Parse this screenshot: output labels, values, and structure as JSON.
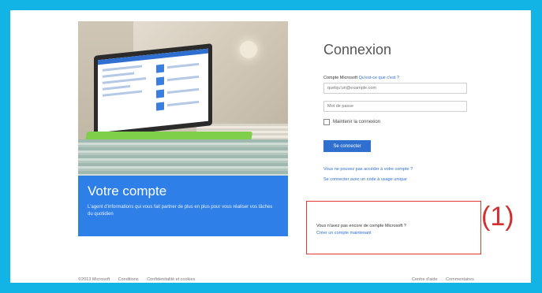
{
  "hero": {
    "title": "Votre compte",
    "description": "L'agent d'informations qui vous fait partner de plus en plus pour vous réaliser vos tâches du quotidien"
  },
  "login": {
    "title": "Connexion",
    "account_label": "Compte Microsoft",
    "what_is_link": "Qu'est-ce que c'est ?",
    "email_placeholder": "quelqu'un@example.com",
    "password_placeholder": "Mot de passe",
    "keep_signed_in": "Maintenir la connexion",
    "submit_label": "Se connecter",
    "cant_access_link": "Vous ne pouvez pas accéder à votre compte ?",
    "single_use_code_link": "Se connecter avec un code à usage unique",
    "no_account_text": "Vous n'avez pas encore de compte Microsoft ?",
    "create_account_link": "Créer un compte maintenant"
  },
  "annotation": {
    "label": "(1)",
    "color": "#d32f2f"
  },
  "footer": {
    "copyright": "©2013 Microsoft",
    "terms": "Conditions",
    "privacy": "Confidentialité et cookies",
    "help_center": "Centre d'aide",
    "feedback": "Commentaires"
  },
  "colors": {
    "background": "#12b4e6",
    "accent": "#2e6fd0",
    "panel": "#2e7fe8"
  }
}
